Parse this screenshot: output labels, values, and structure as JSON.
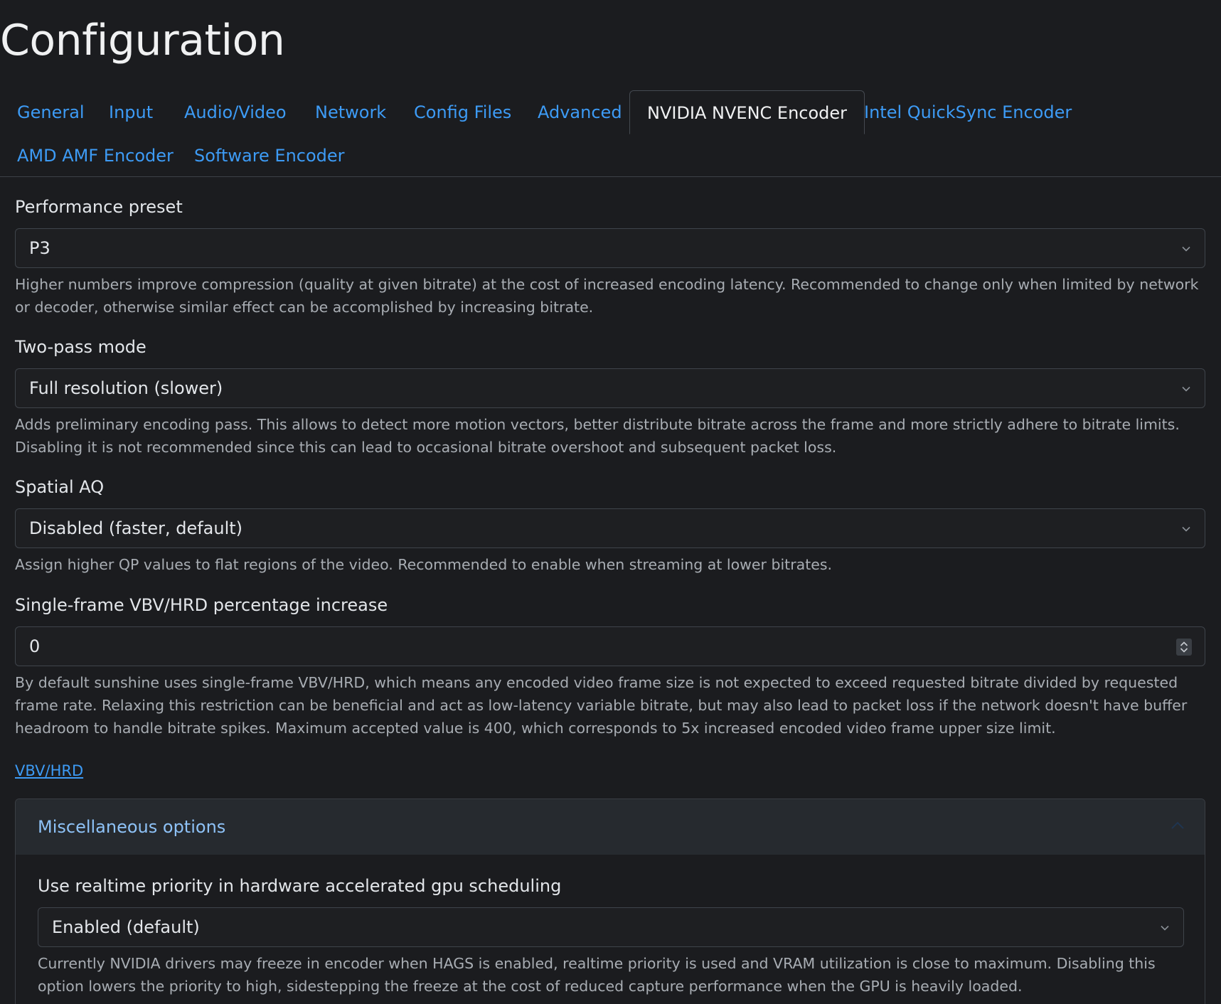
{
  "page": {
    "title": "Configuration"
  },
  "tabs": [
    {
      "label": "General"
    },
    {
      "label": "Input"
    },
    {
      "label": "Audio/Video"
    },
    {
      "label": "Network"
    },
    {
      "label": "Config Files"
    },
    {
      "label": "Advanced"
    },
    {
      "label": "NVIDIA NVENC Encoder",
      "active": true
    },
    {
      "label": "Intel QuickSync Encoder"
    },
    {
      "label": "AMD AMF Encoder"
    },
    {
      "label": "Software Encoder"
    }
  ],
  "fields": {
    "preset": {
      "label": "Performance preset",
      "value": "P3",
      "help": "Higher numbers improve compression (quality at given bitrate) at the cost of increased encoding latency. Recommended to change only when limited by network or decoder, otherwise similar effect can be accomplished by increasing bitrate."
    },
    "twopass": {
      "label": "Two-pass mode",
      "value": "Full resolution (slower)",
      "help": "Adds preliminary encoding pass. This allows to detect more motion vectors, better distribute bitrate across the frame and more strictly adhere to bitrate limits. Disabling it is not recommended since this can lead to occasional bitrate overshoot and subsequent packet loss."
    },
    "spatial_aq": {
      "label": "Spatial AQ",
      "value": "Disabled (faster, default)",
      "help": "Assign higher QP values to flat regions of the video. Recommended to enable when streaming at lower bitrates."
    },
    "vbv": {
      "label": "Single-frame VBV/HRD percentage increase",
      "value": "0",
      "help": "By default sunshine uses single-frame VBV/HRD, which means any encoded video frame size is not expected to exceed requested bitrate divided by requested frame rate. Relaxing this restriction can be beneficial and act as low-latency variable bitrate, but may also lead to packet loss if the network doesn't have buffer headroom to handle bitrate spikes. Maximum accepted value is 400, which corresponds to 5x increased encoded video frame upper size limit.",
      "link": "VBV/HRD"
    }
  },
  "misc": {
    "title": "Miscellaneous options",
    "realtime": {
      "label": "Use realtime priority in hardware accelerated gpu scheduling",
      "value": "Enabled (default)",
      "help": "Currently NVIDIA drivers may freeze in encoder when HAGS is enabled, realtime priority is used and VRAM utilization is close to maximum. Disabling this option lowers the priority to high, sidestepping the freeze at the cost of reduced capture performance when the GPU is heavily loaded."
    }
  }
}
